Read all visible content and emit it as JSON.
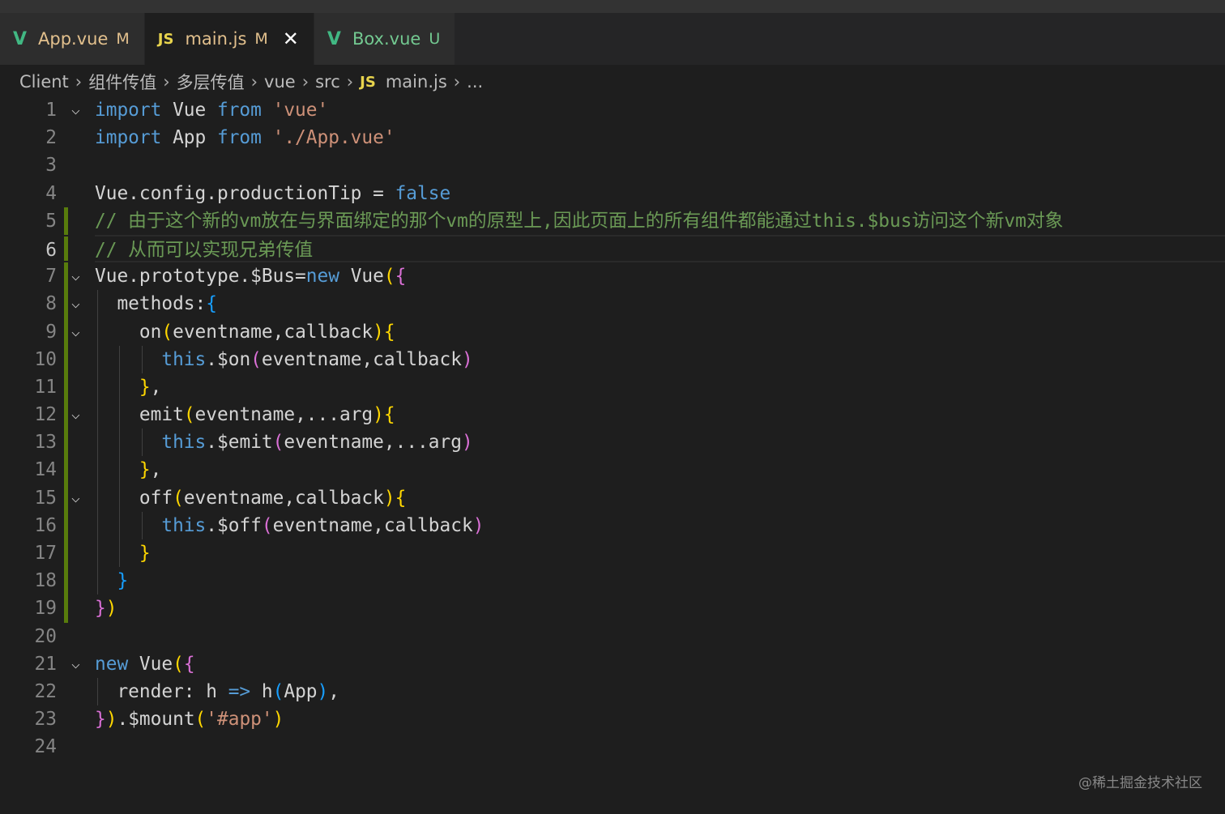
{
  "tabs": [
    {
      "icon": "vue-icon",
      "glyph": "V",
      "label": "App.vue",
      "status": "M",
      "labelColor": "#e2c08d",
      "active": false
    },
    {
      "icon": "js-icon",
      "glyph": "JS",
      "label": "main.js",
      "status": "M",
      "labelColor": "#e2c08d",
      "active": true
    },
    {
      "icon": "vue-icon",
      "glyph": "V",
      "label": "Box.vue",
      "status": "U",
      "labelColor": "#73c991",
      "active": false
    }
  ],
  "breadcrumb": [
    "Client",
    "组件传值",
    "多层传值",
    "vue",
    "src",
    "main.js",
    "..."
  ],
  "breadcrumb_file_icon": "JS",
  "current_line": 6,
  "lines": [
    [
      [
        "import ",
        "kw"
      ],
      [
        "Vue ",
        "id"
      ],
      [
        "from ",
        "kw"
      ],
      [
        "'vue'",
        "str"
      ]
    ],
    [
      [
        "import ",
        "kw"
      ],
      [
        "App ",
        "id"
      ],
      [
        "from ",
        "kw"
      ],
      [
        "'./App.vue'",
        "str"
      ]
    ],
    [],
    [
      [
        "Vue.config.productionTip = ",
        "id"
      ],
      [
        "false",
        "kw"
      ]
    ],
    [
      [
        "// 由于这个新的vm放在与界面绑定的那个vm的原型上,因此页面上的所有组件都能通过this.$bus访问这个新vm对象",
        "com"
      ]
    ],
    [
      [
        "// 从而可以实现兄弟传值",
        "com"
      ]
    ],
    [
      [
        "Vue.prototype.$Bus=",
        "id"
      ],
      [
        "new ",
        "kw"
      ],
      [
        "Vue",
        "id"
      ],
      [
        "(",
        "b1"
      ],
      [
        "{",
        "b2"
      ]
    ],
    [
      [
        "  methods:",
        "id"
      ],
      [
        "{",
        "b3"
      ]
    ],
    [
      [
        "    on",
        "id"
      ],
      [
        "(",
        "b1"
      ],
      [
        "eventname,callback",
        "id"
      ],
      [
        ")",
        "b1"
      ],
      [
        "{",
        "b1"
      ]
    ],
    [
      [
        "      ",
        "id"
      ],
      [
        "this",
        "kw"
      ],
      [
        ".$on",
        "id"
      ],
      [
        "(",
        "b2"
      ],
      [
        "eventname,callback",
        "id"
      ],
      [
        ")",
        "b2"
      ]
    ],
    [
      [
        "    ",
        "id"
      ],
      [
        "}",
        "b1"
      ],
      [
        ",",
        "id"
      ]
    ],
    [
      [
        "    emit",
        "id"
      ],
      [
        "(",
        "b1"
      ],
      [
        "eventname,...arg",
        "id"
      ],
      [
        ")",
        "b1"
      ],
      [
        "{",
        "b1"
      ]
    ],
    [
      [
        "      ",
        "id"
      ],
      [
        "this",
        "kw"
      ],
      [
        ".$emit",
        "id"
      ],
      [
        "(",
        "b2"
      ],
      [
        "eventname,...arg",
        "id"
      ],
      [
        ")",
        "b2"
      ]
    ],
    [
      [
        "    ",
        "id"
      ],
      [
        "}",
        "b1"
      ],
      [
        ",",
        "id"
      ]
    ],
    [
      [
        "    off",
        "id"
      ],
      [
        "(",
        "b1"
      ],
      [
        "eventname,callback",
        "id"
      ],
      [
        ")",
        "b1"
      ],
      [
        "{",
        "b1"
      ]
    ],
    [
      [
        "      ",
        "id"
      ],
      [
        "this",
        "kw"
      ],
      [
        ".$off",
        "id"
      ],
      [
        "(",
        "b2"
      ],
      [
        "eventname,callback",
        "id"
      ],
      [
        ")",
        "b2"
      ]
    ],
    [
      [
        "    ",
        "id"
      ],
      [
        "}",
        "b1"
      ]
    ],
    [
      [
        "  ",
        "id"
      ],
      [
        "}",
        "b3"
      ]
    ],
    [
      [
        "}",
        "b2"
      ],
      [
        ")",
        "b1"
      ]
    ],
    [],
    [
      [
        "new ",
        "kw"
      ],
      [
        "Vue",
        "id"
      ],
      [
        "(",
        "b1"
      ],
      [
        "{",
        "b2"
      ]
    ],
    [
      [
        "  render: h ",
        "id"
      ],
      [
        "=>",
        "kw"
      ],
      [
        " h",
        "id"
      ],
      [
        "(",
        "b3"
      ],
      [
        "App",
        "id"
      ],
      [
        ")",
        "b3"
      ],
      [
        ",",
        "id"
      ]
    ],
    [
      [
        "}",
        "b2"
      ],
      [
        ")",
        "b1"
      ],
      [
        ".$mount",
        "id"
      ],
      [
        "(",
        "b1"
      ],
      [
        "'#app'",
        "str"
      ],
      [
        ")",
        "b1"
      ]
    ],
    []
  ],
  "folds": [
    1,
    7,
    8,
    9,
    12,
    15,
    21
  ],
  "modified_lines": [
    5,
    6,
    7,
    8,
    9,
    10,
    11,
    12,
    13,
    14,
    15,
    16,
    17,
    18,
    19
  ],
  "watermark": "@稀土掘金技术社区"
}
